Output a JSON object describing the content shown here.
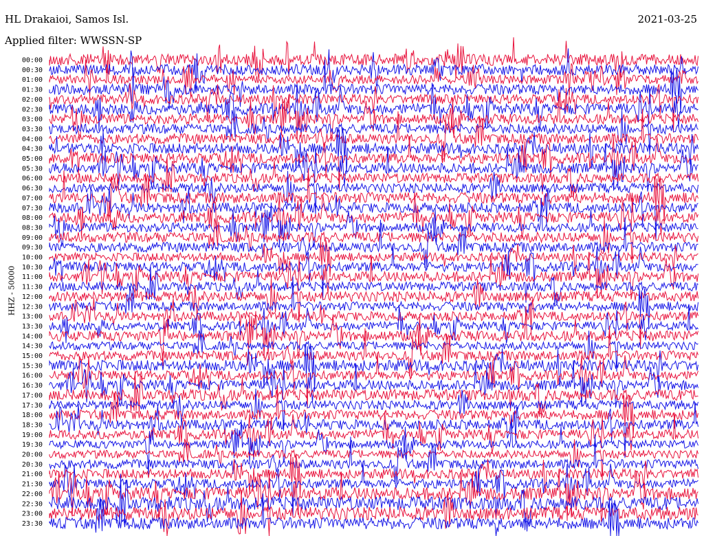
{
  "header": {
    "station": "HL Drakaioi, Samos Isl.",
    "date": "2021-03-25",
    "filter": "Applied filter: WWSSN-SP"
  },
  "chart_data": {
    "type": "line",
    "ylabel": "HHZ - 50000",
    "rows": [
      "00:00",
      "00:30",
      "01:00",
      "01:30",
      "02:00",
      "02:30",
      "03:00",
      "03:30",
      "04:00",
      "04:30",
      "05:00",
      "05:30",
      "06:00",
      "06:30",
      "07:00",
      "07:30",
      "08:00",
      "08:30",
      "09:00",
      "09:30",
      "10:00",
      "10:30",
      "11:00",
      "11:30",
      "12:00",
      "12:30",
      "13:00",
      "13:30",
      "14:00",
      "14:30",
      "15:00",
      "15:30",
      "16:00",
      "16:30",
      "17:00",
      "17:30",
      "18:00",
      "18:30",
      "19:00",
      "19:30",
      "20:00",
      "20:30",
      "21:00",
      "21:30",
      "22:00",
      "22:30",
      "23:00",
      "23:30"
    ],
    "series_colors": [
      "#e8123c",
      "#1414e6"
    ],
    "grid": false,
    "legend": "none"
  }
}
